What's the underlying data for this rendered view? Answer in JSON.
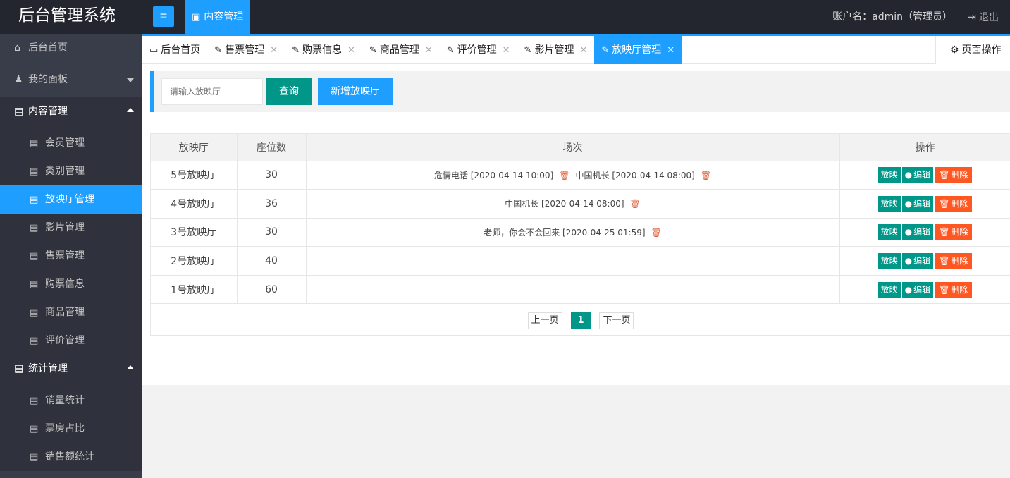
{
  "header": {
    "brand": "后台管理系统",
    "toggle_icon": "≡",
    "module_label": "内容管理",
    "account_text": "账户名：admin（管理员）",
    "logout_label": "退出"
  },
  "sidebar": {
    "home": "后台首页",
    "my_panel": "我的面板",
    "content_mgmt": "内容管理",
    "content_items": [
      "会员管理",
      "类别管理",
      "放映厅管理",
      "影片管理",
      "售票管理",
      "购票信息",
      "商品管理",
      "评价管理"
    ],
    "stats_mgmt": "统计管理",
    "stats_items": [
      "销量统计",
      "票房占比",
      "销售额统计"
    ]
  },
  "tabs": {
    "home": "后台首页",
    "items": [
      "售票管理",
      "购票信息",
      "商品管理",
      "评价管理",
      "影片管理",
      "放映厅管理"
    ],
    "page_ops": "页面操作"
  },
  "toolbar": {
    "search_placeholder": "请输入放映厅",
    "search_button": "查询",
    "add_button": "新增放映厅"
  },
  "table": {
    "headers": [
      "放映厅",
      "座位数",
      "场次",
      "操作"
    ],
    "rows": [
      {
        "hall": "5号放映厅",
        "seats": "30",
        "sessions": [
          "危情电话 [2020-04-14 10:00]",
          "中国机长 [2020-04-14 08:00]"
        ]
      },
      {
        "hall": "4号放映厅",
        "seats": "36",
        "sessions": [
          "中国机长 [2020-04-14 08:00]"
        ]
      },
      {
        "hall": "3号放映厅",
        "seats": "30",
        "sessions": [
          "老师，你会不会回来 [2020-04-25 01:59]"
        ]
      },
      {
        "hall": "2号放映厅",
        "seats": "40",
        "sessions": []
      },
      {
        "hall": "1号放映厅",
        "seats": "60",
        "sessions": []
      }
    ],
    "actions": {
      "play": "放映",
      "edit": "编辑",
      "delete": "删除"
    }
  },
  "pager": {
    "prev": "上一页",
    "current": "1",
    "next": "下一页"
  },
  "colors": {
    "accent": "#1e9fff",
    "primary": "#009688",
    "danger": "#ff5722",
    "sidebar_bg": "#393d49",
    "header_bg": "#23262e"
  }
}
